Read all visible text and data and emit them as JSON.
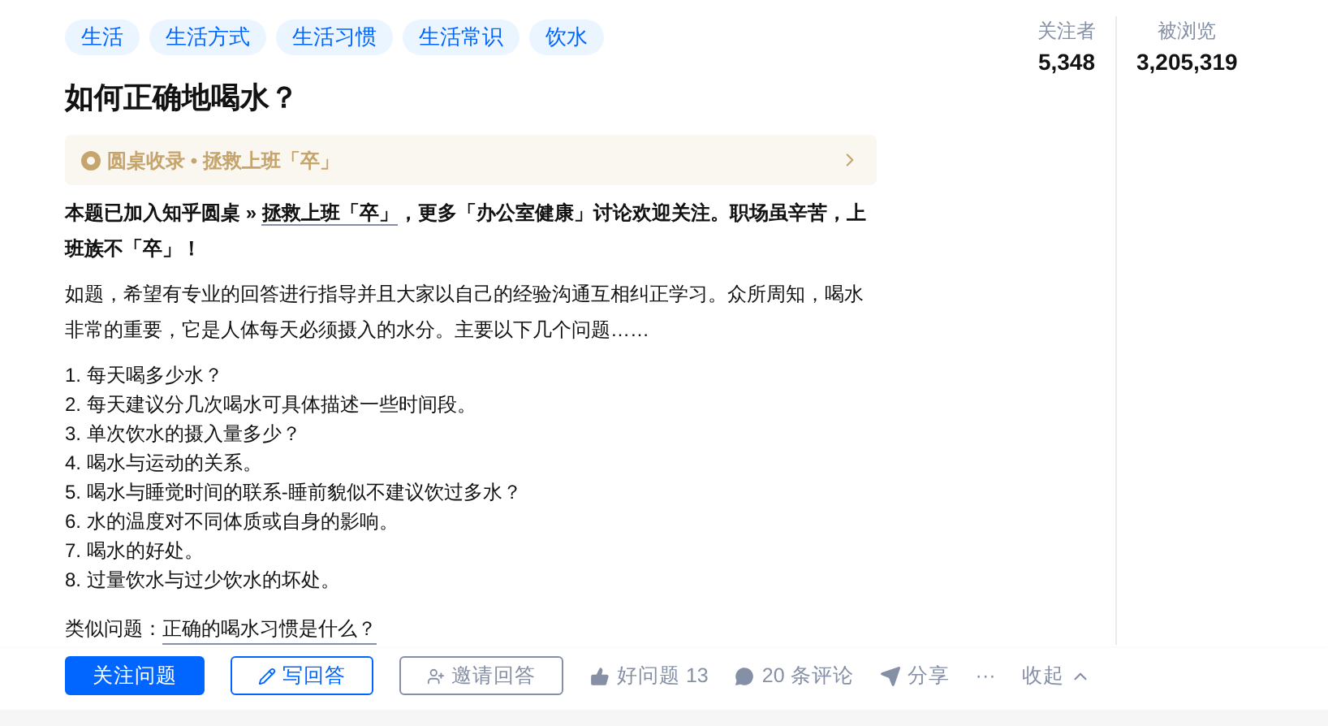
{
  "tags": [
    "生活",
    "生活方式",
    "生活习惯",
    "生活常识",
    "饮水"
  ],
  "title": "如何正确地喝水？",
  "roundtable": {
    "label": "圆桌收录 • 拯救上班「卒」"
  },
  "notice": {
    "prefix": "本题已加入知乎圆桌 » ",
    "link": "拯救上班「卒」",
    "suffix": "，更多「办公室健康」讨论欢迎关注。职场虽辛苦，上班族不「卒」！"
  },
  "description": "如题，希望有专业的回答进行指导并且大家以自己的经验沟通互相纠正学习。众所周知，喝水非常的重要，它是人体每天必须摄入的水分。主要以下几个问题……",
  "questions": [
    "1. 每天喝多少水？",
    "2. 每天建议分几次喝水可具体描述一些时间段。",
    "3. 单次饮水的摄入量多少？",
    "4. 喝水与运动的关系。",
    "5. 喝水与睡觉时间的联系-睡前貌似不建议饮过多水？",
    "6. 水的温度对不同体质或自身的影响。",
    "7. 喝水的好处。",
    "8. 过量饮水与过少饮水的坏处。"
  ],
  "similar": {
    "label": "类似问题：",
    "link": "正确的喝水习惯是什么？"
  },
  "buttons": [
    {
      "kind": "primary",
      "label": "关注问题"
    },
    {
      "kind": "write",
      "label": "写回答"
    },
    {
      "kind": "invite",
      "label": "邀请回答"
    }
  ],
  "actions": [
    {
      "kind": "like",
      "label": "好问题 13"
    },
    {
      "kind": "comment",
      "label": "20 条评论"
    },
    {
      "kind": "share",
      "label": "分享"
    },
    {
      "kind": "more",
      "label": "···"
    },
    {
      "kind": "collapse",
      "label": "收起"
    }
  ],
  "stats": [
    {
      "label": "关注者",
      "value": "5,348"
    },
    {
      "label": "被浏览",
      "value": "3,205,319"
    }
  ]
}
